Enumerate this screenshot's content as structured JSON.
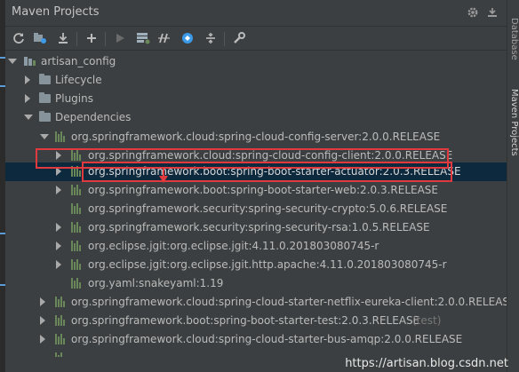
{
  "panel": {
    "title": "Maven Projects"
  },
  "toolbar": {
    "buttons": [
      "refresh-icon",
      "reimport-icon",
      "download-icon",
      "add-icon",
      "run-icon",
      "execute-goal-icon",
      "skip-tests-icon",
      "lifecycle-icon",
      "collapse-icon",
      "settings-wrench-icon"
    ]
  },
  "tree": {
    "root": "artisan_config",
    "lifecycle": "Lifecycle",
    "plugins": "Plugins",
    "dependencies": "Dependencies",
    "deps": [
      "org.springframework.cloud:spring-cloud-config-server:2.0.0.RELEASE",
      "org.springframework.cloud:spring-cloud-config-client:2.0.0.RELEASE",
      "org.springframework.boot:spring-boot-starter-actuator:2.0.3.RELEASE",
      "org.springframework.boot:spring-boot-starter-web:2.0.3.RELEASE",
      "org.springframework.security:spring-security-crypto:5.0.6.RELEASE",
      "org.springframework.security:spring-security-rsa:1.0.5.RELEASE",
      "org.eclipse.jgit:org.eclipse.jgit:4.11.0.201803080745-r",
      "org.eclipse.jgit:org.eclipse.jgit.http.apache:4.11.0.201803080745-r",
      "org.yaml:snakeyaml:1.19",
      "org.springframework.cloud:spring-cloud-starter-netflix-eureka-client:2.0.0.RELEASE",
      "org.springframework.boot:spring-boot-starter-test:2.0.3.RELEASE",
      "(test)",
      "org.springframework.cloud:spring-cloud-starter-bus-amqp:2.0.0.RELEASE"
    ]
  },
  "side_tabs": {
    "database": "Database",
    "maven": "Maven Projects"
  },
  "watermark": "https://artisan.blog.csdn.net",
  "colors": {
    "selection": "#0d293e",
    "highlight_box": "#e0393e",
    "library_icon": "#6a8759"
  }
}
